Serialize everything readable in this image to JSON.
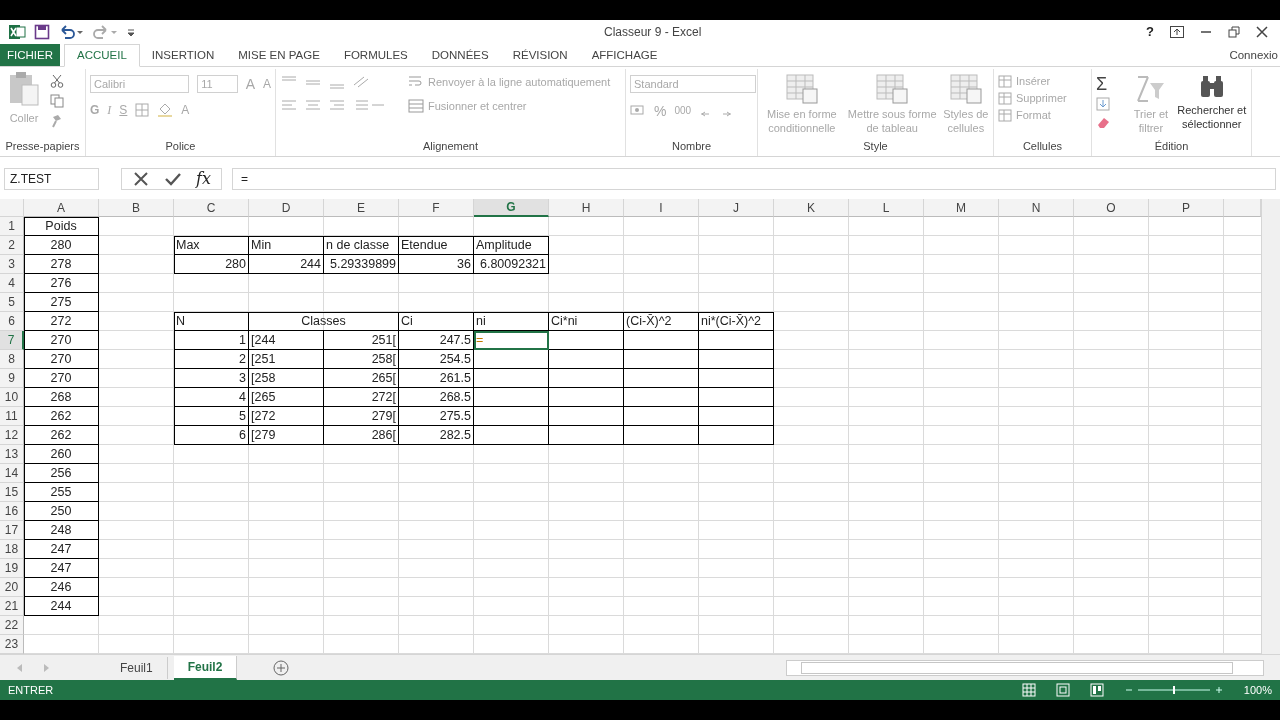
{
  "title_bar": {
    "title": "Classeur 9 - Excel",
    "help": "?"
  },
  "ribbon_tabs": [
    {
      "label": "FICHIER",
      "kind": "file",
      "selected": false
    },
    {
      "label": "ACCUEIL",
      "kind": "tab",
      "selected": true
    },
    {
      "label": "INSERTION",
      "kind": "tab",
      "selected": false
    },
    {
      "label": "MISE EN PAGE",
      "kind": "tab",
      "selected": false
    },
    {
      "label": "FORMULES",
      "kind": "tab",
      "selected": false
    },
    {
      "label": "DONNÉES",
      "kind": "tab",
      "selected": false
    },
    {
      "label": "RÉVISION",
      "kind": "tab",
      "selected": false
    },
    {
      "label": "AFFICHAGE",
      "kind": "tab",
      "selected": false
    }
  ],
  "account": "Connexio",
  "ribbon": {
    "disabled": true,
    "clipboard": {
      "label": "Presse-papiers",
      "paste": "Coller"
    },
    "font": {
      "label": "Police",
      "font_name": "Calibri",
      "font_size": "11",
      "grow": "A",
      "shrink": "A",
      "bold": "G",
      "italic": "I",
      "underline": "S",
      "font_color_button": "A"
    },
    "alignment": {
      "label": "Alignement",
      "wrap": "Renvoyer à la ligne automatiquement",
      "merge": "Fusionner et centrer"
    },
    "number": {
      "label": "Nombre",
      "format": "Standard",
      "percent": "%",
      "thousands": "000"
    },
    "style": {
      "label": "Style",
      "buttons": [
        "Mise en forme conditionnelle",
        "Mettre sous forme de tableau",
        "Styles de cellules"
      ]
    },
    "cells": {
      "label": "Cellules",
      "buttons": [
        "Insérer",
        "Supprimer",
        "Format"
      ]
    },
    "editing": {
      "label": "Édition",
      "sum": "Σ",
      "buttons": [
        "Trier et filtrer",
        "Rechercher et sélectionner"
      ]
    }
  },
  "formula_bar": {
    "name_box": "Z.TEST",
    "fx": "fx",
    "formula": "="
  },
  "columns": [
    {
      "label": "A",
      "selected": false
    },
    {
      "label": "B",
      "selected": false
    },
    {
      "label": "C",
      "selected": false
    },
    {
      "label": "D",
      "selected": false
    },
    {
      "label": "E",
      "selected": false
    },
    {
      "label": "F",
      "selected": false
    },
    {
      "label": "G",
      "selected": true
    },
    {
      "label": "H",
      "selected": false
    },
    {
      "label": "I",
      "selected": false
    },
    {
      "label": "J",
      "selected": false
    },
    {
      "label": "K",
      "selected": false
    },
    {
      "label": "L",
      "selected": false
    },
    {
      "label": "M",
      "selected": false
    },
    {
      "label": "N",
      "selected": false
    },
    {
      "label": "O",
      "selected": false
    },
    {
      "label": "P",
      "selected": false
    }
  ],
  "rows": [
    {
      "label": "1",
      "selected": false
    },
    {
      "label": "2",
      "selected": false
    },
    {
      "label": "3",
      "selected": false
    },
    {
      "label": "4",
      "selected": false
    },
    {
      "label": "5",
      "selected": false
    },
    {
      "label": "6",
      "selected": false
    },
    {
      "label": "7",
      "selected": true
    },
    {
      "label": "8",
      "selected": false
    },
    {
      "label": "9",
      "selected": false
    },
    {
      "label": "10",
      "selected": false
    },
    {
      "label": "11",
      "selected": false
    },
    {
      "label": "12",
      "selected": false
    },
    {
      "label": "13",
      "selected": false
    },
    {
      "label": "14",
      "selected": false
    },
    {
      "label": "15",
      "selected": false
    },
    {
      "label": "16",
      "selected": false
    },
    {
      "label": "17",
      "selected": false
    },
    {
      "label": "18",
      "selected": false
    },
    {
      "label": "19",
      "selected": false
    },
    {
      "label": "20",
      "selected": false
    },
    {
      "label": "21",
      "selected": false
    },
    {
      "label": "22",
      "selected": false
    },
    {
      "label": "23",
      "selected": false
    }
  ],
  "weights": {
    "header": "Poids",
    "values": [
      "280",
      "278",
      "276",
      "275",
      "272",
      "270",
      "270",
      "270",
      "268",
      "262",
      "262",
      "260",
      "256",
      "255",
      "250",
      "248",
      "247",
      "247",
      "246",
      "244"
    ]
  },
  "summary": {
    "headers": [
      "Max",
      "Min",
      "n de classe",
      "Etendue",
      "Amplitude"
    ],
    "values": [
      "280",
      "244",
      "5.29339899",
      "36",
      "6.80092321"
    ]
  },
  "classes": {
    "headers": [
      "N",
      "Classes",
      "Ci",
      "ni",
      "Ci*ni",
      "(Ci-X̄)^2",
      "ni*(Ci-X̄)^2"
    ],
    "rows": [
      {
        "n": "1",
        "lower": "[244",
        "upper": "251[",
        "ci": "247.5",
        "ni": "=",
        "selected": true
      },
      {
        "n": "2",
        "lower": "[251",
        "upper": "258[",
        "ci": "254.5",
        "selected": false
      },
      {
        "n": "3",
        "lower": "[258",
        "upper": "265[",
        "ci": "261.5",
        "selected": false
      },
      {
        "n": "4",
        "lower": "[265",
        "upper": "272[",
        "ci": "268.5",
        "selected": false
      },
      {
        "n": "5",
        "lower": "[272",
        "upper": "279[",
        "ci": "275.5",
        "selected": false
      },
      {
        "n": "6",
        "lower": "[279",
        "upper": "286[",
        "ci": "282.5",
        "selected": false
      }
    ]
  },
  "sheet_tabs": [
    {
      "label": "Feuil1",
      "selected": false
    },
    {
      "label": "Feuil2",
      "selected": true
    }
  ],
  "status_bar": {
    "mode": "ENTRER",
    "zoom_slider": {
      "level": 0.5
    },
    "zoom": "100%"
  }
}
